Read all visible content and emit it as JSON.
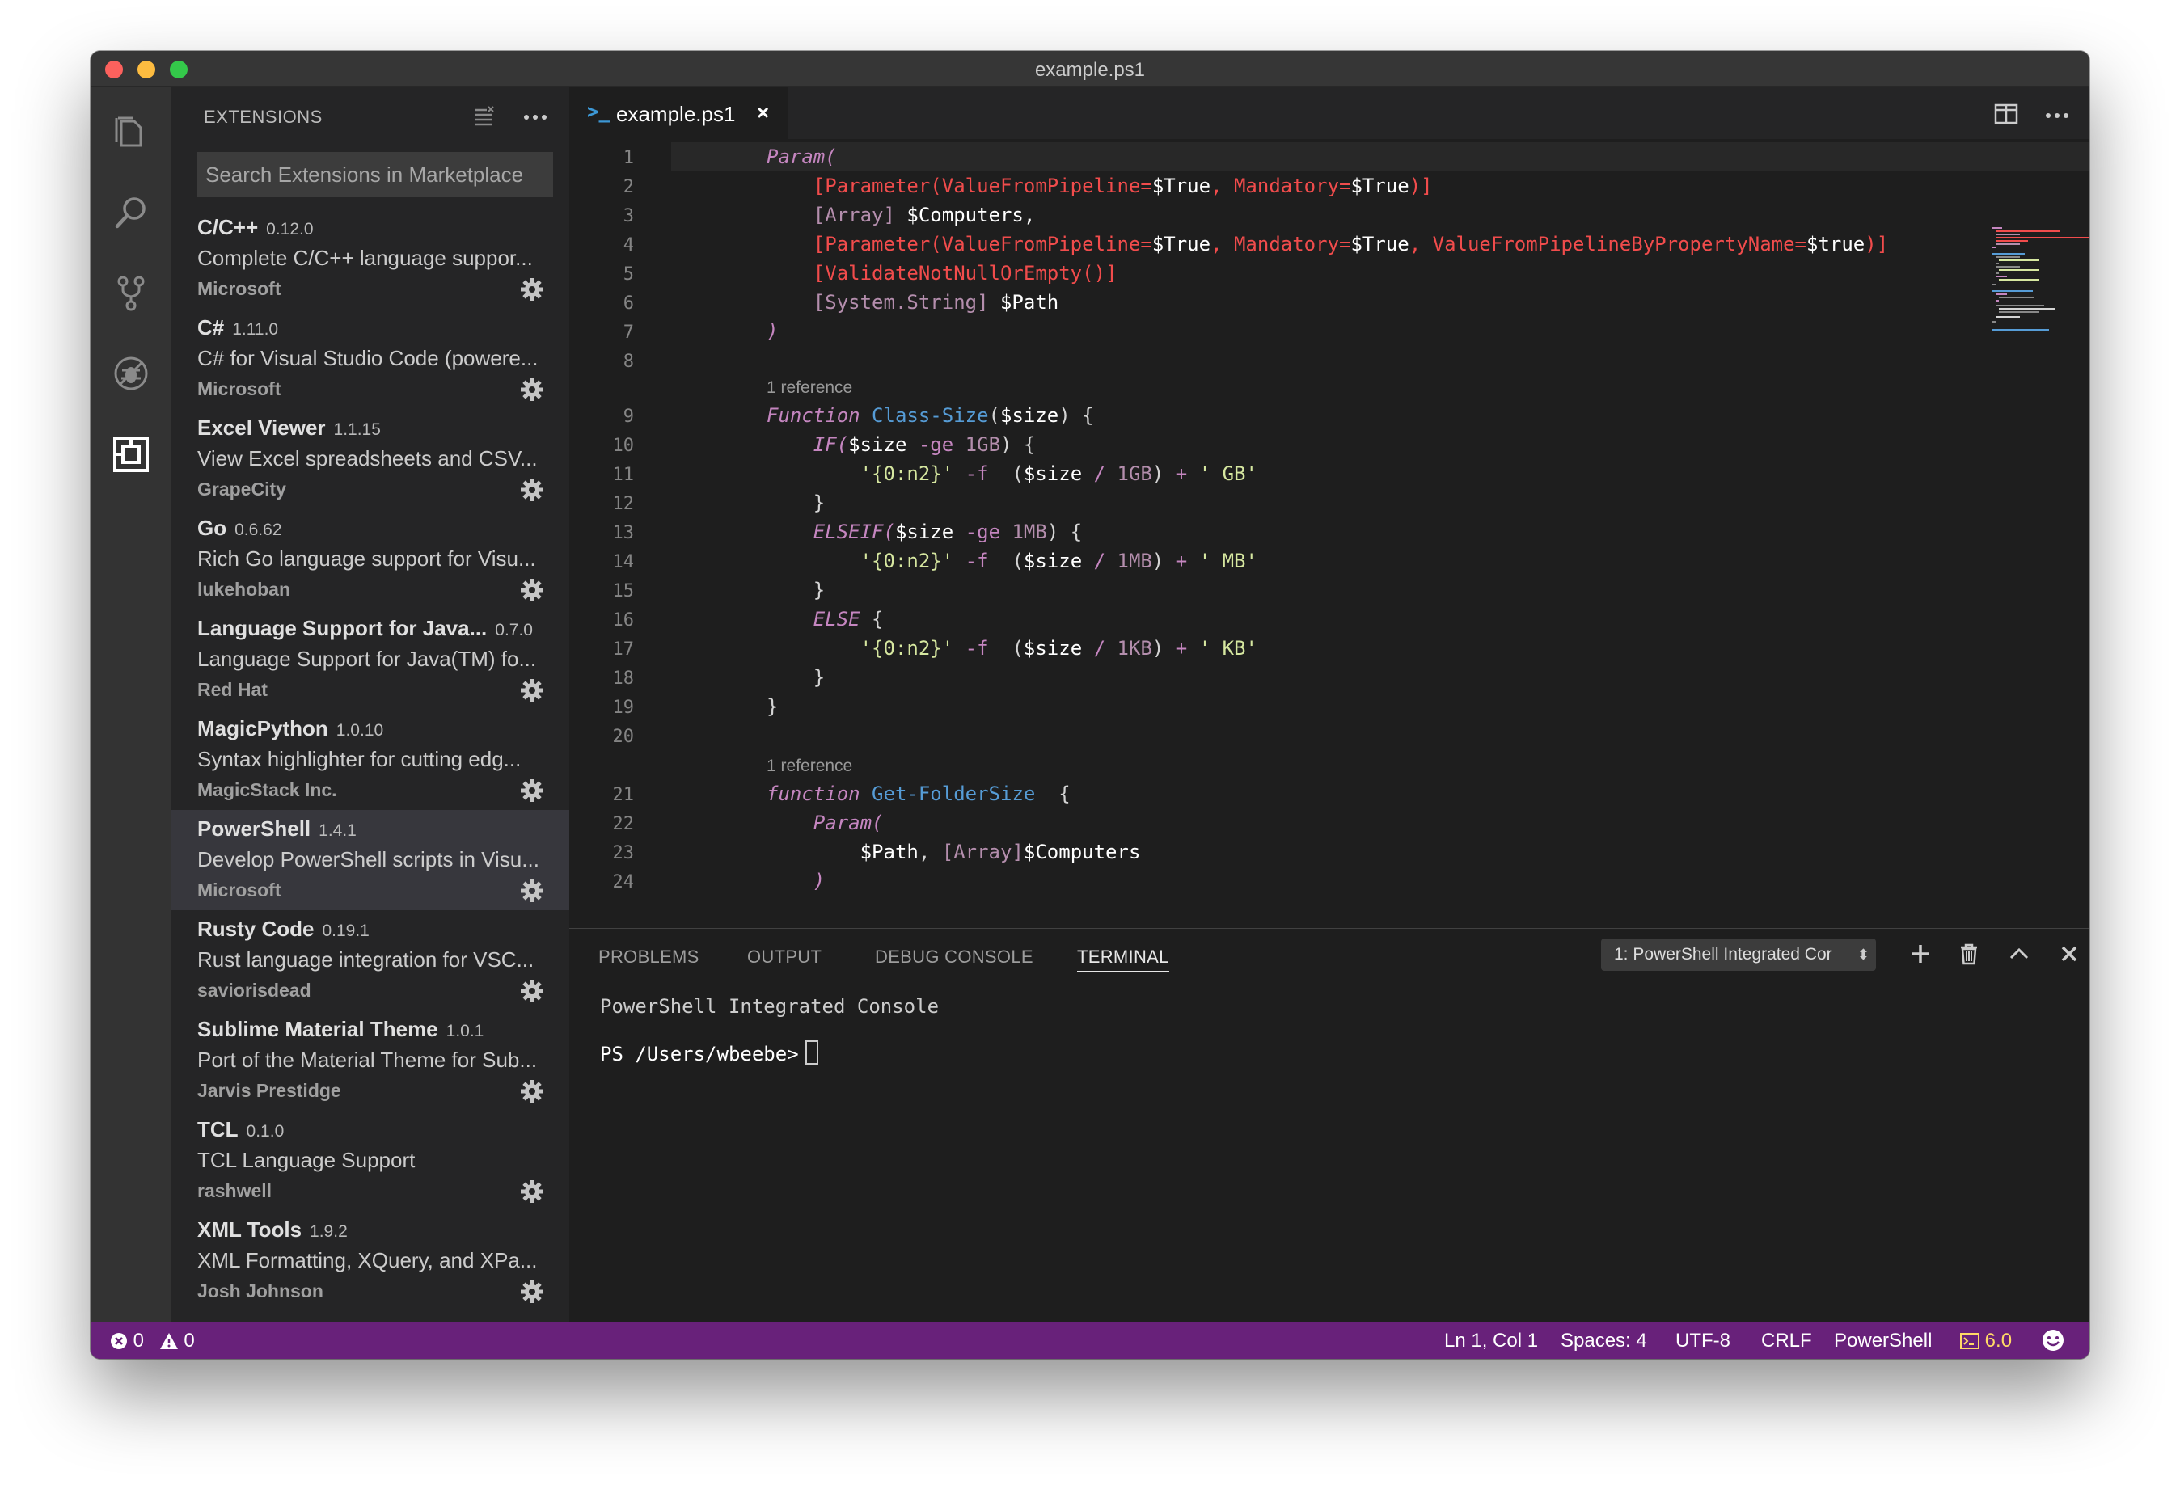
{
  "window": {
    "title": "example.ps1"
  },
  "sidebar": {
    "title": "EXTENSIONS",
    "search_placeholder": "Search Extensions in Marketplace",
    "extensions": [
      {
        "name": "C/C++",
        "version": "0.12.0",
        "description": "Complete C/C++ language suppor...",
        "publisher": "Microsoft"
      },
      {
        "name": "C#",
        "version": "1.11.0",
        "description": "C# for Visual Studio Code (powere...",
        "publisher": "Microsoft"
      },
      {
        "name": "Excel Viewer",
        "version": "1.1.15",
        "description": "View Excel spreadsheets and CSV...",
        "publisher": "GrapeCity"
      },
      {
        "name": "Go",
        "version": "0.6.62",
        "description": "Rich Go language support for Visu...",
        "publisher": "lukehoban"
      },
      {
        "name": "Language Support for Java...",
        "version": "0.7.0",
        "description": "Language Support for Java(TM) fo...",
        "publisher": "Red Hat"
      },
      {
        "name": "MagicPython",
        "version": "1.0.10",
        "description": "Syntax highlighter for cutting edg...",
        "publisher": "MagicStack Inc."
      },
      {
        "name": "PowerShell",
        "version": "1.4.1",
        "description": "Develop PowerShell scripts in Visu...",
        "publisher": "Microsoft"
      },
      {
        "name": "Rusty Code",
        "version": "0.19.1",
        "description": "Rust language integration for VSC...",
        "publisher": "saviorisdead"
      },
      {
        "name": "Sublime Material Theme",
        "version": "1.0.1",
        "description": "Port of the Material Theme for Sub...",
        "publisher": "Jarvis Prestidge"
      },
      {
        "name": "TCL",
        "version": "0.1.0",
        "description": "TCL Language Support",
        "publisher": "rashwell"
      },
      {
        "name": "XML Tools",
        "version": "1.9.2",
        "description": "XML Formatting, XQuery, and XPa...",
        "publisher": "Josh Johnson"
      }
    ]
  },
  "editor": {
    "tab": {
      "icon": ">_",
      "label": "example.ps1",
      "close": "×"
    },
    "codelens": "1 reference",
    "line_numbers": [
      "1",
      "2",
      "3",
      "4",
      "5",
      "6",
      "7",
      "8",
      "9",
      "10",
      "11",
      "12",
      "13",
      "14",
      "15",
      "16",
      "17",
      "18",
      "19",
      "20",
      "21",
      "22",
      "23",
      "24"
    ],
    "code": {
      "l1": "Param(",
      "l2a": "[Parameter(ValueFromPipeline=",
      "l2b": "$True",
      "l2c": ", Mandatory=",
      "l2d": "$True",
      "l2e": ")]",
      "l3a": "[Array] ",
      "l3b": "$Computers,",
      "l4a": "[Parameter(ValueFromPipeline=",
      "l4b": "$True",
      "l4c": ", Mandatory=",
      "l4d": "$True",
      "l4e": ", ValueFromPipelineByPropertyName=",
      "l4f": "$true",
      "l4g": ")]",
      "l5": "[ValidateNotNullOrEmpty()]",
      "l6a": "[System.String] ",
      "l6b": "$Path",
      "l7": ")",
      "l9a": "Function",
      "l9b": "Class-Size",
      "l9c": "(",
      "l9d": "$size",
      "l9e": ") {",
      "l10a": "IF(",
      "l10b": "$size",
      "l10c": "-ge",
      "l10d": "1GB",
      "l10e": ") {",
      "l11a": "'{0:n2}'",
      "l11b": "-f",
      "l11c": "(",
      "l11d": "$size",
      "l11e": "/",
      "l11f": "1GB",
      "l11g": ")",
      "l11h": "+",
      "l11i": "' GB'",
      "l12": "}",
      "l13a": "ELSEIF(",
      "l13b": "$size",
      "l13c": "-ge",
      "l13d": "1MB",
      "l13e": ") {",
      "l14i": "' MB'",
      "l14f": "1MB",
      "l16a": "ELSE",
      "l16b": "{",
      "l17i": "' KB'",
      "l17f": "1KB",
      "l19": "}",
      "l21a": "function",
      "l21b": "Get-FolderSize",
      "l21c": "{",
      "l22": "Param(",
      "l23a": "$Path",
      "l23b": ", ",
      "l23c": "[Array]",
      "l23d": "$Computers",
      "l24": ")"
    }
  },
  "panel": {
    "tabs": [
      "PROBLEMS",
      "OUTPUT",
      "DEBUG CONSOLE",
      "TERMINAL"
    ],
    "active_tab": "TERMINAL",
    "terminal_select": "1: PowerShell Integrated Cor",
    "terminal_select_arrow": "⬍",
    "terminal_header": "PowerShell Integrated Console",
    "prompt": "PS /Users/wbeebe>"
  },
  "statusbar": {
    "errors": "0",
    "warnings": "0",
    "position": "Ln 1, Col 1",
    "spaces": "Spaces: 4",
    "encoding": "UTF-8",
    "eol": "CRLF",
    "language": "PowerShell",
    "ps_version": "6.0"
  },
  "colors": {
    "statusbar": "#68217a",
    "accent_tab_icon": "#3c97d4",
    "sidebar_bg": "#252526",
    "editor_bg": "#1e1e1e"
  },
  "icons": {
    "activity": [
      "files-icon",
      "search-icon",
      "source-control-icon",
      "debug-icon",
      "extensions-icon"
    ],
    "status": [
      "error-icon",
      "warning-icon",
      "terminal-version-icon",
      "smiley-feedback-icon"
    ]
  }
}
